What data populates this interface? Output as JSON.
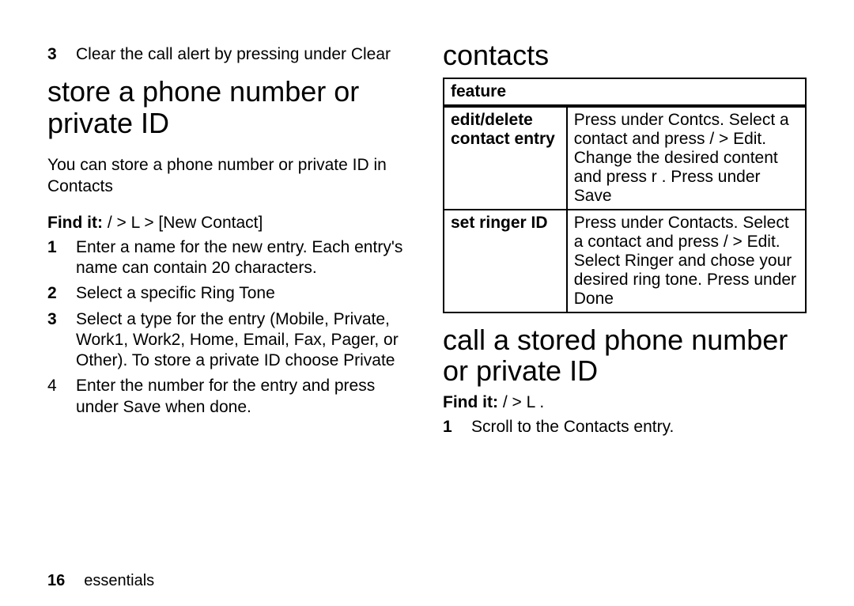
{
  "left": {
    "prev_step_num": "3",
    "prev_step": "Clear the call alert by pressing      under Clear",
    "h1": "store a phone number or private ID",
    "intro": "You can store a phone number or private ID in Contacts",
    "find_lbl": "Find it:",
    "find_path": "/      > L   > [New Contact]",
    "steps": [
      {
        "n": "1",
        "bold": true,
        "t": "Enter a name for the new entry. Each entry's name can contain 20 characters."
      },
      {
        "n": "2",
        "bold": true,
        "t": "Select a specific Ring Tone"
      },
      {
        "n": "3",
        "bold": true,
        "t": "Select a type for the entry (Mobile, Private, Work1, Work2, Home, Email, Fax, Pager, or Other). To store a private ID choose Private"
      },
      {
        "n": "4",
        "bold": false,
        "t": "Enter the number for the entry and press      under Save when done."
      }
    ]
  },
  "right": {
    "h1a": "contacts",
    "th": "feature",
    "rows": [
      {
        "feat": "edit/delete contact entry",
        "desc": "Press      under Contcs. Select a contact and press /      > Edit. Change the desired content and press r   . Press      under Save"
      },
      {
        "feat": "set ringer ID",
        "desc": "Press      under Contacts. Select a contact and press /      > Edit. Select Ringer and chose your desired ring tone. Press      under Done"
      }
    ],
    "h1b": "call a stored phone number or private ID",
    "find_lbl": "Find it:",
    "find_path": "/      > L  .",
    "steps2": [
      {
        "n": "1",
        "t": "Scroll to the Contacts entry."
      }
    ]
  },
  "footer": {
    "page": "16",
    "section": "essentials"
  }
}
